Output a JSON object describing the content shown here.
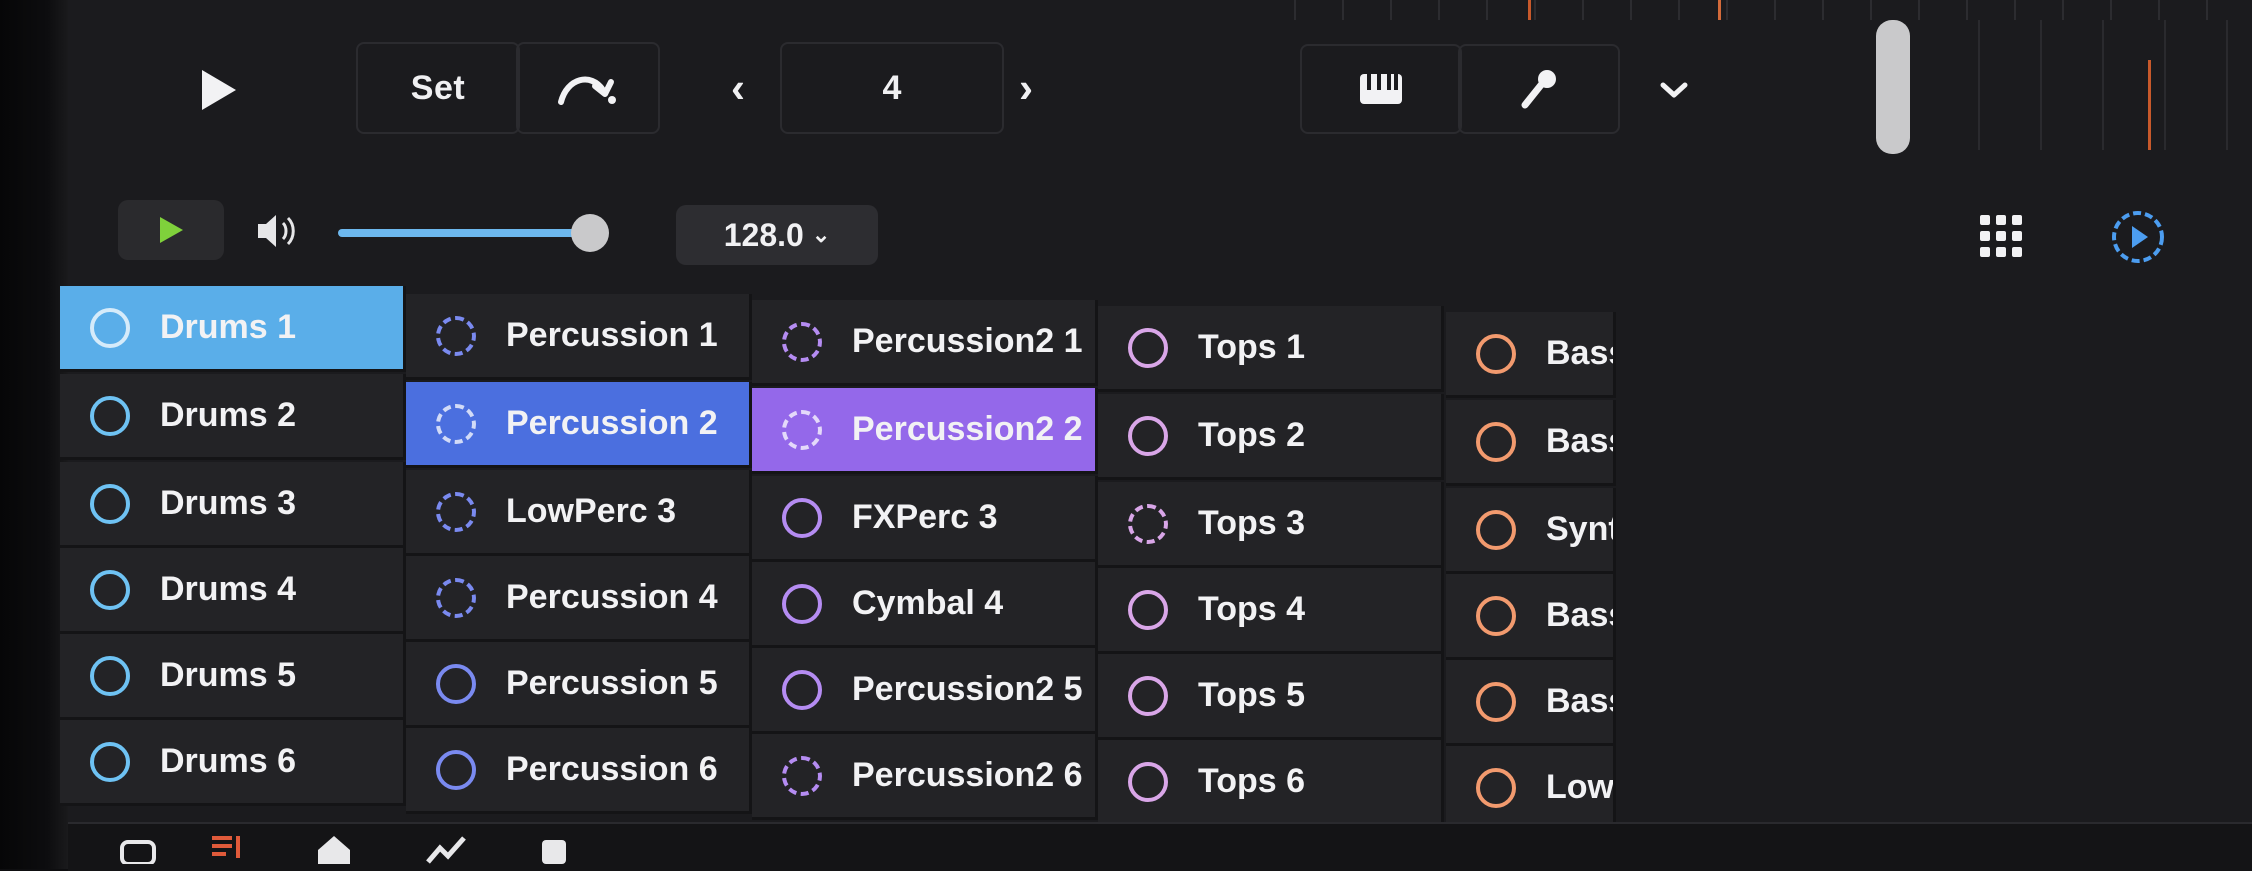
{
  "toolbar": {
    "set_label": "Set",
    "bar_number": "4",
    "icons": [
      "play-icon",
      "redo-icon",
      "chevron-left-icon",
      "chevron-right-icon",
      "keyboard-icon",
      "microphone-icon",
      "chevron-down-icon"
    ]
  },
  "transport": {
    "volume_level": 0.9,
    "tempo": "128.0",
    "icons": [
      "play-icon",
      "speaker-icon",
      "grid-icon",
      "circle-play-icon"
    ]
  },
  "colors": {
    "drums": "#6ec2f3",
    "drums_selected_bg": "#5aaee9",
    "percussion": "#7a8af0",
    "percussion_selected_bg": "#4b6fdf",
    "percussion2": "#b58cf2",
    "percussion2_selected_bg": "#9468ea",
    "tops": "#d9a6e8",
    "bass": "#f29a6e"
  },
  "columns": [
    {
      "key": "drums",
      "clips": [
        {
          "label": "Drums 1",
          "style": "solid",
          "selected": true
        },
        {
          "label": "Drums 2",
          "style": "solid",
          "selected": false
        },
        {
          "label": "Drums 3",
          "style": "solid",
          "selected": false
        },
        {
          "label": "Drums 4",
          "style": "solid",
          "selected": false
        },
        {
          "label": "Drums 5",
          "style": "solid",
          "selected": false
        },
        {
          "label": "Drums 6",
          "style": "solid",
          "selected": false
        }
      ]
    },
    {
      "key": "percussion",
      "clips": [
        {
          "label": "Percussion 1",
          "style": "dash",
          "selected": false
        },
        {
          "label": "Percussion 2",
          "style": "dash",
          "selected": true
        },
        {
          "label": "LowPerc 3",
          "style": "dash",
          "selected": false
        },
        {
          "label": "Percussion 4",
          "style": "dash",
          "selected": false
        },
        {
          "label": "Percussion 5",
          "style": "solid",
          "selected": false
        },
        {
          "label": "Percussion 6",
          "style": "solid",
          "selected": false
        }
      ]
    },
    {
      "key": "percussion2",
      "clips": [
        {
          "label": "Percussion2 1",
          "style": "dash",
          "selected": false
        },
        {
          "label": "Percussion2 2",
          "style": "dash",
          "selected": true
        },
        {
          "label": "FXPerc 3",
          "style": "solid",
          "selected": false
        },
        {
          "label": "Cymbal 4",
          "style": "solid",
          "selected": false
        },
        {
          "label": "Percussion2 5",
          "style": "solid",
          "selected": false
        },
        {
          "label": "Percussion2 6",
          "style": "dash",
          "selected": false
        }
      ]
    },
    {
      "key": "tops",
      "clips": [
        {
          "label": "Tops 1",
          "style": "solid",
          "selected": false
        },
        {
          "label": "Tops 2",
          "style": "solid",
          "selected": false
        },
        {
          "label": "Tops 3",
          "style": "dash",
          "selected": false
        },
        {
          "label": "Tops 4",
          "style": "solid",
          "selected": false
        },
        {
          "label": "Tops 5",
          "style": "solid",
          "selected": false
        },
        {
          "label": "Tops 6",
          "style": "solid",
          "selected": false
        }
      ]
    },
    {
      "key": "bass",
      "clips": [
        {
          "label": "Bass",
          "style": "solid",
          "selected": false
        },
        {
          "label": "Bass",
          "style": "solid",
          "selected": false
        },
        {
          "label": "Synth",
          "style": "solid",
          "selected": false
        },
        {
          "label": "Bass",
          "style": "solid",
          "selected": false
        },
        {
          "label": "Bass",
          "style": "solid",
          "selected": false
        },
        {
          "label": "LowP",
          "style": "solid",
          "selected": false
        }
      ]
    }
  ],
  "bottom_bar": {
    "status_text": "",
    "icons": [
      "library-icon",
      "score-icon",
      "home-icon",
      "automation-icon",
      "share-icon"
    ]
  }
}
